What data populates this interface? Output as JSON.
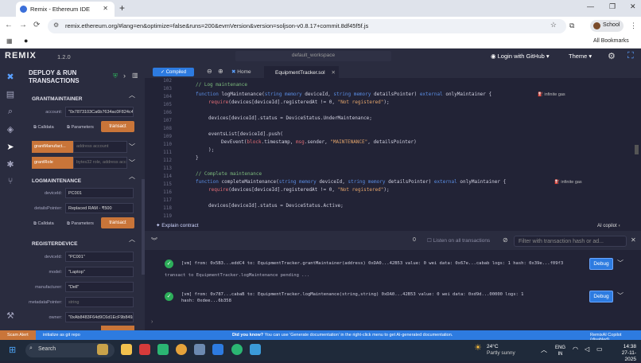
{
  "browser": {
    "tab_title": "Remix - Ethereum IDE",
    "url": "remix.ethereum.org/#lang=en&optimize=false&runs=200&evmVersion&version=soljson-v0.8.17+commit.8df45f5f.js",
    "profile": "School",
    "bookmarks": "All Bookmarks"
  },
  "remix": {
    "logo": "REMIX",
    "version": "1.2.0",
    "workspace": "default_workspace",
    "github_login": "Login with GitHub",
    "theme": "Theme"
  },
  "panel": {
    "title": "DEPLOY & RUN TRANSACTIONS",
    "sections": {
      "grantmaintainer": {
        "title": "GRANTMAINTAINER",
        "account_label": "account:",
        "account_value": "\"0x7873103Ca6b7634ac0F824c42a",
        "calldata": "Calldata",
        "parameters": "Parameters",
        "transact": "transact"
      },
      "grantmanufact": {
        "button": "grantManufact...",
        "placeholder": "address account"
      },
      "grantrole": {
        "button": "grantRole",
        "placeholder": "bytes32 role, address accou"
      },
      "logmaintenance": {
        "title": "LOGMAINTENANCE",
        "deviceid_label": "deviceId:",
        "deviceid_value": "PC001",
        "details_label": "detailsPointer:",
        "details_value": "Replaced RAM - ₹500",
        "calldata": "Calldata",
        "parameters": "Parameters",
        "transact": "transact"
      },
      "registerdevice": {
        "title": "REGISTERDEVICE",
        "deviceid_label": "deviceId:",
        "deviceid_value": "\"PC001\"",
        "model_label": "model:",
        "model_value": "\"Laptop\"",
        "manufacturer_label": "manufacturer:",
        "manufacturer_value": "\"Dell\"",
        "metadata_label": "metadataPointer:",
        "metadata_value": "string",
        "owner_label": "owner:",
        "owner_value": "\"0xAb8483F64d9C6d1EcF9b849Ae6"
      }
    }
  },
  "editor": {
    "compiled": "Compiled",
    "home": "Home",
    "file": "EquipmentTracker.sol",
    "infinite_gas": "infinite gas",
    "line_numbers": [
      "102",
      "103",
      "104",
      "105",
      "106",
      "107",
      "108",
      "109",
      "110",
      "111",
      "112",
      "113",
      "114",
      "115",
      "116",
      "117",
      "118",
      "119"
    ],
    "explain": "Explain contract",
    "ai_copilot": "AI copilot"
  },
  "terminal": {
    "count": "0",
    "listen": "Listen on all transactions",
    "filter_placeholder": "Filter with transaction hash or ad...",
    "log1_line1": "[vm] from: 0x5B3...eddC4 to: EquipmentTracker.grantMaintainer(address) 0xDA0...42B53 value: 0 wei data: 0x67e...cabab logs: 1 hash: 0x39e...f09f3",
    "pending": "transact to EquipmentTracker.logMaintenance pending ...",
    "log2_line1": "[vm] from: 0x787...cabaB to: EquipmentTracker.logMaintenance(string,string) 0xDA0...42B53 value: 0 wei data: 0xd9d...00000 logs: 1",
    "log2_line2": "hash: 0xdee...6b358",
    "debug": "Debug"
  },
  "statusbar": {
    "scam": "Scam Alert",
    "initialize": "initialize as git repo",
    "did_you_know": "Did you know?",
    "tip": "You can use 'Generate documentation' in the right-click menu to get AI-generated documentation.",
    "copilot": "RemixAI Copilot (disabled)"
  },
  "taskbar": {
    "search": "Search",
    "temp": "24°C",
    "weather": "Partly sunny",
    "lang1": "ENG",
    "lang2": "IN",
    "time": "14:38",
    "date": "27-11-2025"
  },
  "colors": {
    "accent": "#2d7be0",
    "transact": "#c97539",
    "bg": "#222336",
    "panel": "#2a2c3f"
  }
}
